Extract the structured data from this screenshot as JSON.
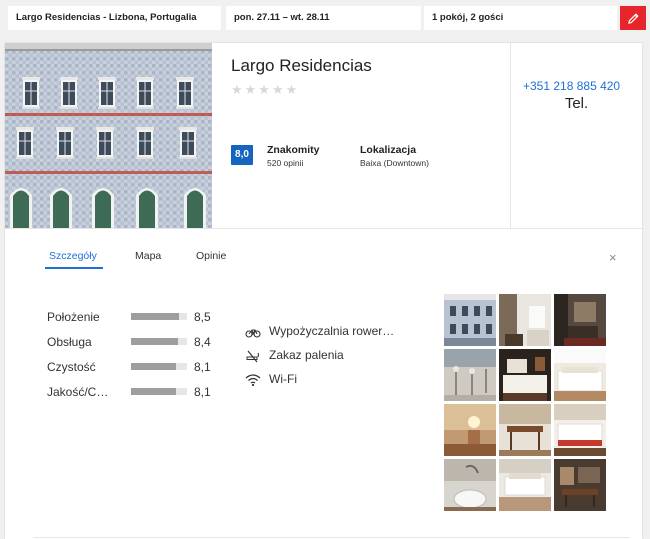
{
  "search": {
    "destination": "Largo Residencias - Lizbona, Portugalia",
    "dates": "pon. 27.11  –  wt. 28.11",
    "guests": "1 pokój, 2 gości",
    "edit_icon": "pencil-icon",
    "accent": "#e6262b"
  },
  "hotel": {
    "name": "Largo Residencias",
    "stars_text": "★★★★★",
    "score": "8,0",
    "rating_label": "Znakomity",
    "reviews": "520 opinii",
    "location_label": "Lokalizacja",
    "location_value": "Baixa (Downtown)",
    "phone": "+351 218 885 420",
    "phone_label": "Tel.",
    "score_color": "#1565c0",
    "link_color": "#1e6fd9"
  },
  "tabs": [
    {
      "label": "Szczegóły",
      "active": true
    },
    {
      "label": "Mapa",
      "active": false
    },
    {
      "label": "Opinie",
      "active": false
    }
  ],
  "close_label": "×",
  "scores": [
    {
      "label": "Położenie",
      "value": "8,5",
      "fraction": 0.85
    },
    {
      "label": "Obsługa",
      "value": "8,4",
      "fraction": 0.84
    },
    {
      "label": "Czystość",
      "value": "8,1",
      "fraction": 0.81
    },
    {
      "label": "Jakość/C…",
      "value": "8,1",
      "fraction": 0.81
    }
  ],
  "amenities": [
    {
      "label": "Wypożyczalnia rower…",
      "icon": "bicycle-icon"
    },
    {
      "label": "Zakaz palenia",
      "icon": "no-smoking-icon"
    },
    {
      "label": "Wi-Fi",
      "icon": "wifi-icon"
    }
  ]
}
